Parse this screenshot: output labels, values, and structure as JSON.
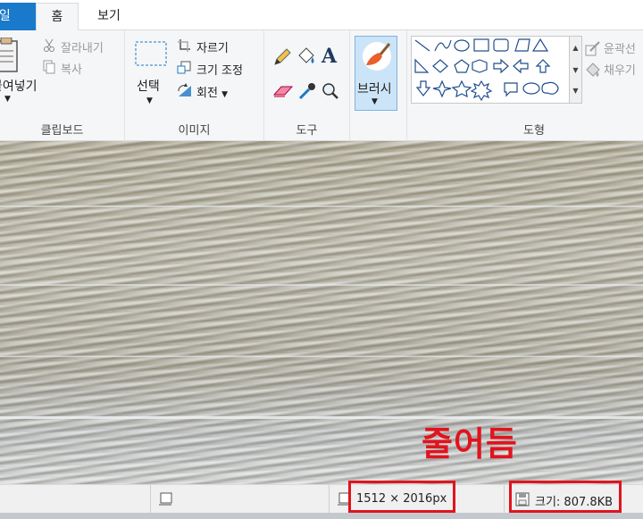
{
  "tabs": {
    "file": "파일",
    "home": "홈",
    "view": "보기"
  },
  "clipboard": {
    "paste": "붙여넣기",
    "cut": "잘라내기",
    "copy": "복사",
    "label": "클립보드"
  },
  "image": {
    "select": "선택",
    "crop": "자르기",
    "resize": "크기 조정",
    "rotate": "회전",
    "label": "이미지"
  },
  "tools": {
    "label": "도구",
    "text_glyph": "A"
  },
  "brushes": {
    "label": "브러시"
  },
  "shapes": {
    "label": "도형",
    "outline": "윤곽선",
    "fill": "채우기"
  },
  "canvas": {
    "annotation": "줄어듬"
  },
  "status": {
    "dimensions": "1512 × 2016px",
    "size": "크기: 807.8KB"
  },
  "colors": {
    "accent": "#1979ca",
    "highlight": "#e0141e"
  }
}
